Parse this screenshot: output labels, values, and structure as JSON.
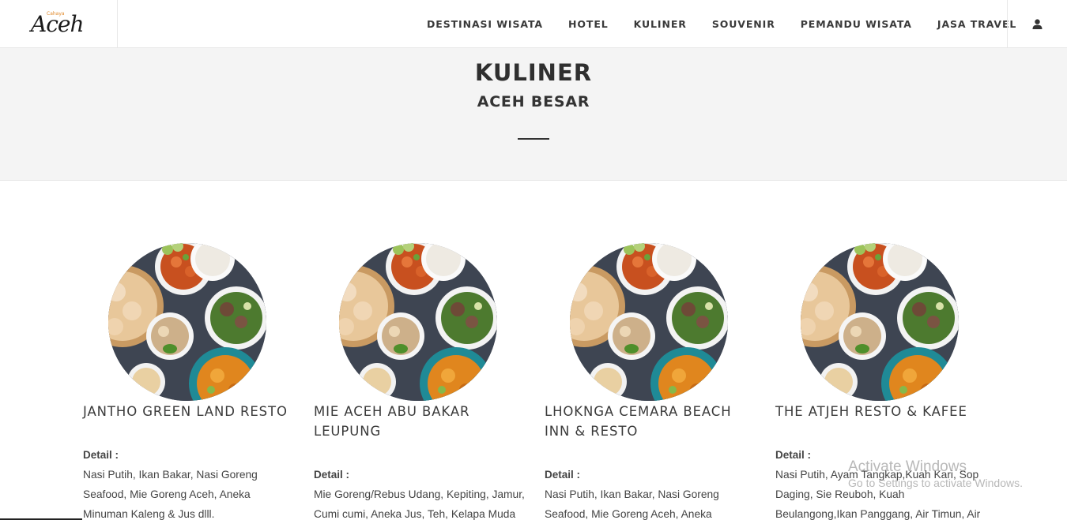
{
  "brand": {
    "logo_text": "Aceh",
    "logo_small": "Cahaya"
  },
  "nav": {
    "items": [
      {
        "label": "DESTINASI WISATA"
      },
      {
        "label": "HOTEL"
      },
      {
        "label": "KULINER"
      },
      {
        "label": "SOUVENIR"
      },
      {
        "label": "PEMANDU WISATA"
      },
      {
        "label": "JASA TRAVEL"
      }
    ],
    "user_icon": "user-icon"
  },
  "hero": {
    "title": "KULINER",
    "subtitle": "ACEH BESAR"
  },
  "cards": [
    {
      "name": "JANTHO GREEN LAND RESTO",
      "detail_label": "Detail :",
      "detail": "Nasi Putih, Ikan Bakar, Nasi Goreng Seafood, Mie Goreng Aceh, Aneka Minuman Kaleng & Jus dlll."
    },
    {
      "name": "MIE ACEH ABU BAKAR LEUPUNG",
      "detail_label": "Detail :",
      "detail": "Mie Goreng/Rebus Udang, Kepiting, Jamur, Cumi cumi, Aneka Jus, Teh, Kelapa Muda"
    },
    {
      "name": "LHOKNGA CEMARA BEACH INN & RESTO",
      "detail_label": "Detail :",
      "detail": "Nasi Putih, Ikan Bakar, Nasi Goreng Seafood, Mie Goreng Aceh, Aneka"
    },
    {
      "name": "THE ATJEH RESTO & KAFEE",
      "detail_label": "Detail :",
      "detail": "Nasi Putih, Ayam Tangkap,Kuah Kari, Sop Daging, Sie Reuboh, Kuah Beulangong,Ikan Panggang, Air Timun, Air Pepaya dll"
    }
  ],
  "watermark": {
    "line1": "Activate Windows",
    "line2": "Go to Settings to activate Windows."
  },
  "colors": {
    "hero_bg": "#f4f4f4",
    "text": "#333333",
    "logo_accent": "#e08a2c"
  }
}
